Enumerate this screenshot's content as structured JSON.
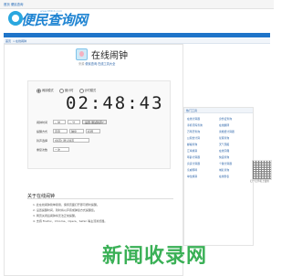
{
  "top_links": "首页  便民查询",
  "logo": {
    "brand": "便民查询网",
    "url": "www.8MCX.com"
  },
  "breadcrumb": {
    "home": "首页",
    "current": "在线闹钟"
  },
  "app": {
    "title": "在线闹钟",
    "sub_prefix": "来源 ",
    "sub_link1": "便民查询",
    "sub_link2": "在线工具大全"
  },
  "radios": [
    "闹钟模式",
    "倒计时",
    "计时模式"
  ],
  "clock": "02:48:43",
  "form": {
    "row1_label": "闹钟时间",
    "row1_sel1": "-- 时",
    "row1_sel2": "-- 分",
    "row1_btn": "设置·测试铃声?",
    "row2_label": "提醒方式",
    "row2_opt1": "声音",
    "row2_opt2": "弹窗",
    "row2_opt3": "标题",
    "row3_label": "铃声选择",
    "row3_sel": "[铃声] 默认铃声",
    "row4_label": "重复次数",
    "row4_sel": "一次"
  },
  "about": {
    "title": "关于在线闹钟",
    "items": [
      "1. 此在线闹钟简单易用，保持页面打开即可按时提醒。",
      "2. 设置提醒时间，到时将以声音或弹窗方式提醒您。",
      "3. 网页关闭后闹钟将无法正常提醒。",
      "4. 支持 Firefox、Chrome、Opera、Safari 等主流浏览器。"
    ]
  },
  "sidebar": {
    "head": "热门工具",
    "tools": [
      "在线计算器",
      "身份证查询",
      "手机号码查询",
      "在线翻译",
      "万年历查询",
      "离婚费计算器",
      "公积金计算",
      "星座查询",
      "邮编查询",
      "天气预报",
      "汇率换算",
      "在线字典",
      "年龄计算器",
      "快递查询",
      "房贷计算器",
      "个税计算器",
      "亲戚称呼",
      "域名查询",
      "单位换算",
      "在线秒表"
    ]
  },
  "qr_caption": "扫一扫手机上使用",
  "watermark": "新闻收录网",
  "colors": {
    "nav": "#1e74c9",
    "link": "#2a63a8",
    "watermark": "#25a844"
  }
}
